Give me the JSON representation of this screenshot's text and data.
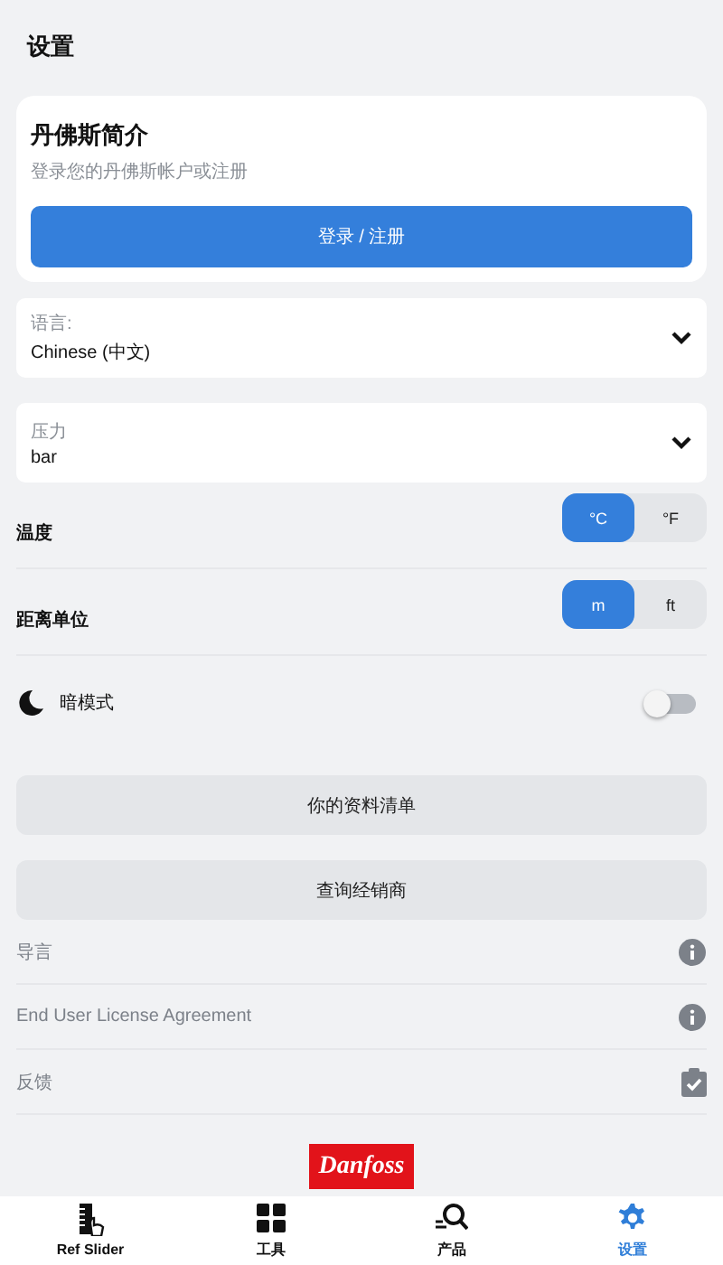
{
  "header": {
    "title": "设置"
  },
  "profile_card": {
    "title": "丹佛斯简介",
    "subtitle": "登录您的丹佛斯帐户或注册",
    "button": "登录 / 注册"
  },
  "dropdowns": [
    {
      "label": "语言:",
      "value": "Chinese (中文)"
    },
    {
      "label": "压力",
      "value": "bar"
    }
  ],
  "unit_settings": [
    {
      "label": "温度",
      "options": [
        {
          "label": "°C",
          "selected": true
        },
        {
          "label": "°F",
          "selected": false
        }
      ]
    },
    {
      "label": "距离单位",
      "options": [
        {
          "label": "m",
          "selected": true
        },
        {
          "label": "ft",
          "selected": false
        }
      ]
    }
  ],
  "dark_mode": {
    "label": "暗模式",
    "on": false
  },
  "buttons": [
    "你的资料清单",
    "查询经销商"
  ],
  "links": [
    {
      "label": "导言",
      "kind": "info"
    },
    {
      "label": "End User License Agreement",
      "kind": "info"
    },
    {
      "label": "反馈",
      "kind": "feedback"
    }
  ],
  "logo": {
    "text": "Danfoss"
  },
  "nav": [
    {
      "label": "Ref Slider",
      "kind": "slider",
      "selected": false
    },
    {
      "label": "工具",
      "kind": "grid",
      "selected": false
    },
    {
      "label": "产品",
      "kind": "search",
      "selected": false
    },
    {
      "label": "设置",
      "kind": "settings",
      "selected": true
    }
  ]
}
